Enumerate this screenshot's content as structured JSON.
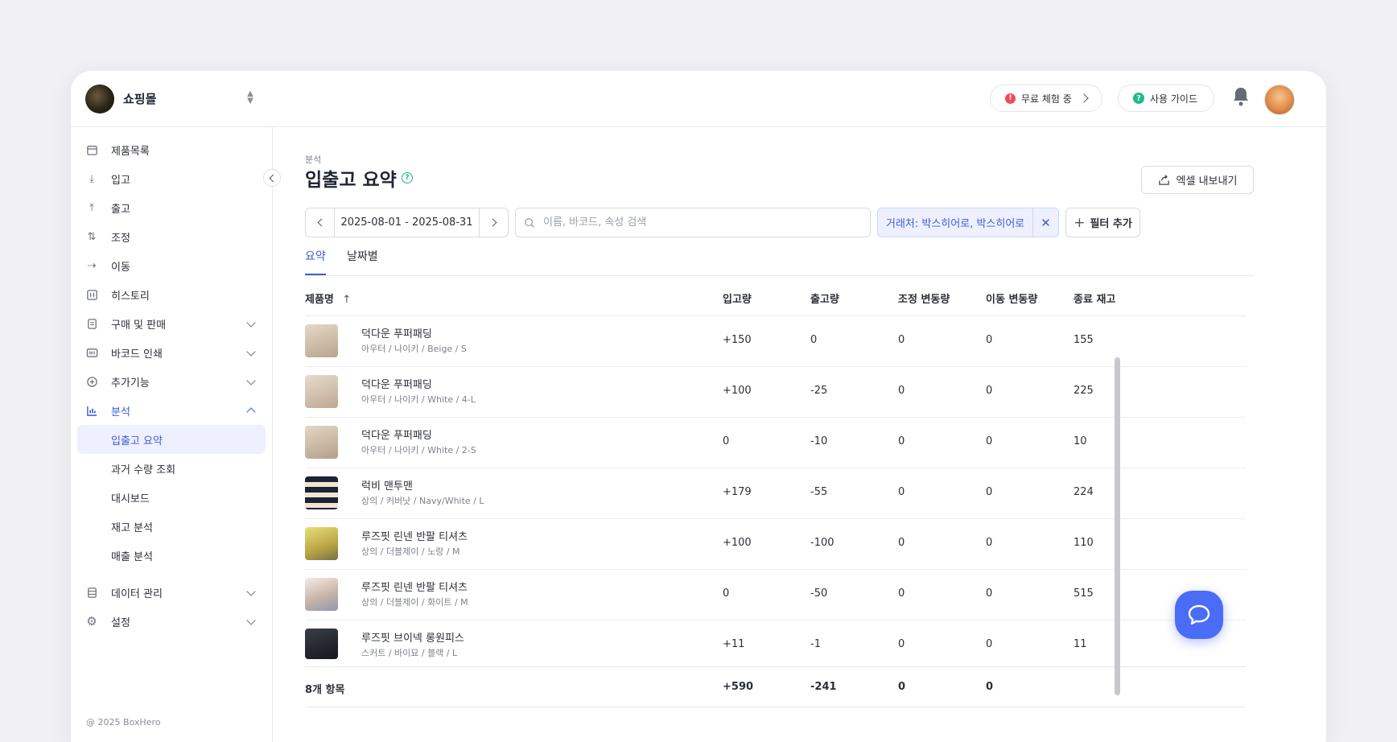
{
  "header": {
    "shop_name": "쇼핑몰",
    "trial_label": "무료 체험 중",
    "guide_label": "사용 가이드"
  },
  "sidebar": {
    "items": [
      {
        "label": "제품목록",
        "icon": "box-icon"
      },
      {
        "label": "입고",
        "icon": "arrow-down-icon"
      },
      {
        "label": "출고",
        "icon": "arrow-up-icon"
      },
      {
        "label": "조정",
        "icon": "swap-vertical-icon"
      },
      {
        "label": "이동",
        "icon": "arrow-right-icon"
      },
      {
        "label": "히스토리",
        "icon": "history-icon"
      },
      {
        "label": "구매 및 판매",
        "icon": "document-icon"
      },
      {
        "label": "바코드 인쇄",
        "icon": "barcode-icon"
      },
      {
        "label": "추가기능",
        "icon": "plus-circle-icon"
      },
      {
        "label": "분석",
        "icon": "bar-chart-icon"
      }
    ],
    "analysis_sub": [
      "입출고 요약",
      "과거 수량 조회",
      "대시보드",
      "재고 분석",
      "매출 분석"
    ],
    "bottom_items": [
      {
        "label": "데이터 관리",
        "icon": "database-icon"
      },
      {
        "label": "설정",
        "icon": "gear-icon"
      }
    ],
    "copyright": "@ 2025 BoxHero"
  },
  "main": {
    "breadcrumb": "분석",
    "title": "입출고 요약",
    "export_label": "엑셀 내보내기",
    "date_range": "2025-08-01 - 2025-08-31",
    "search_placeholder": "이름, 바코드, 속성 검색",
    "filter_chip": "거래처: 박스히어로, 박스히어로",
    "add_filter_label": "필터 추가",
    "tabs": [
      "요약",
      "날짜별"
    ]
  },
  "table": {
    "columns": [
      "제품명",
      "입고량",
      "출고량",
      "조정 변동량",
      "이동 변동량",
      "종료 재고"
    ],
    "rows": [
      {
        "name": "덕다운 푸퍼패딩",
        "attrs": "아우터 / 나이키 / Beige / S",
        "in": "+150",
        "out": "0",
        "adj": "0",
        "move": "0",
        "end": "155"
      },
      {
        "name": "덕다운 푸퍼패딩",
        "attrs": "아우터 / 나이키 / White / 4-L",
        "in": "+100",
        "out": "-25",
        "adj": "0",
        "move": "0",
        "end": "225"
      },
      {
        "name": "덕다운 푸퍼패딩",
        "attrs": "아우터 / 나이키 / White / 2-S",
        "in": "0",
        "out": "-10",
        "adj": "0",
        "move": "0",
        "end": "10"
      },
      {
        "name": "럭비 맨투맨",
        "attrs": "상의 / 커버낫 / Navy/White / L",
        "in": "+179",
        "out": "-55",
        "adj": "0",
        "move": "0",
        "end": "224"
      },
      {
        "name": "루즈핏 린넨 반팔 티셔츠",
        "attrs": "상의 / 더블제이 / 노랑 / M",
        "in": "+100",
        "out": "-100",
        "adj": "0",
        "move": "0",
        "end": "110"
      },
      {
        "name": "루즈핏 린넨 반팔 티셔츠",
        "attrs": "상의 / 더블제이 / 화이트 / M",
        "in": "0",
        "out": "-50",
        "adj": "0",
        "move": "0",
        "end": "515"
      },
      {
        "name": "루즈핏 브이넥 롱원피스",
        "attrs": "스커트 / 바이묘 / 블랙 / L",
        "in": "+11",
        "out": "-1",
        "adj": "0",
        "move": "0",
        "end": "11"
      }
    ],
    "footer": {
      "count": "8개 항목",
      "in": "+590",
      "out": "-241",
      "adj": "0",
      "move": "0"
    }
  },
  "colors": {
    "accent": "#3d5bd9",
    "chat": "#4a6cf7",
    "trial_dot": "#ef4d56",
    "guide_dot": "#1cba8c"
  }
}
